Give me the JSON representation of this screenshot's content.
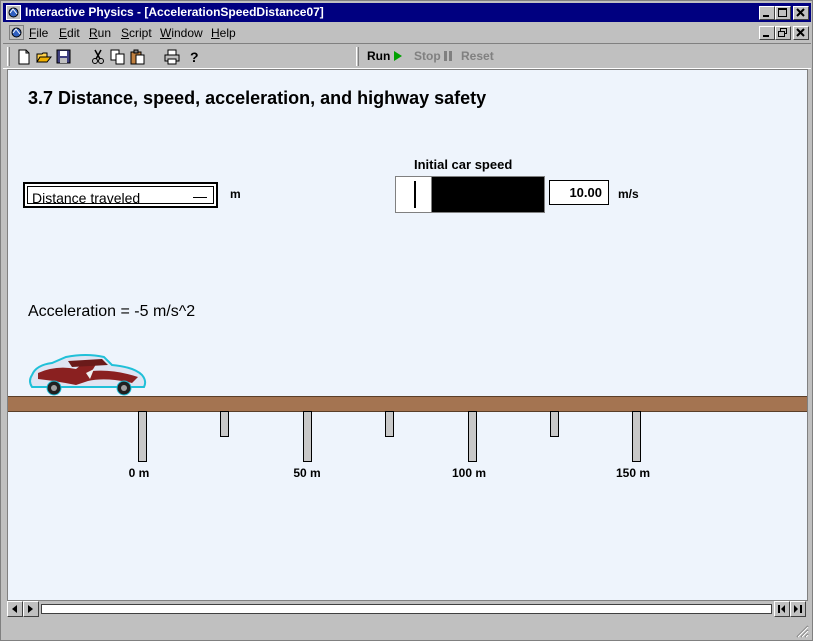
{
  "window": {
    "title": "Interactive Physics - [AccelerationSpeedDistance07]",
    "app_icon": "interactive-physics-icon",
    "controls": [
      "minimize-icon",
      "maximize-icon",
      "close-icon"
    ]
  },
  "menubar": {
    "items": [
      {
        "label": "File",
        "key": "F"
      },
      {
        "label": "Edit",
        "key": "E"
      },
      {
        "label": "Run",
        "key": "R"
      },
      {
        "label": "Script",
        "key": "S"
      },
      {
        "label": "Window",
        "key": "W"
      },
      {
        "label": "Help",
        "key": "H"
      }
    ],
    "doc_controls": [
      "minimize-icon",
      "restore-icon",
      "close-icon"
    ]
  },
  "toolbar": {
    "buttons": [
      "new-file-icon",
      "open-folder-icon",
      "save-disk-icon",
      "cut-scissors-icon",
      "copy-icon",
      "paste-icon",
      "print-icon",
      "help-question-icon"
    ],
    "run_label": "Run",
    "stop_label": "Stop",
    "reset_label": "Reset"
  },
  "canvas": {
    "heading": "3.7 Distance, speed, acceleration, and highway safety",
    "distance_meter": {
      "label": "Distance traveled",
      "unit": "m"
    },
    "speed_slider": {
      "title": "Initial car speed",
      "value": "10.00",
      "unit": "m/s",
      "fraction": 0.25
    },
    "acceleration": "Acceleration = -5 m/s^2",
    "distance_labels": [
      "0 m",
      "50 m",
      "100 m",
      "150 m"
    ]
  },
  "colors": {
    "title_bar": "#000080",
    "canvas_bg": "#eef4fc",
    "road": "#a47451",
    "run_arrow": "#00a000"
  }
}
